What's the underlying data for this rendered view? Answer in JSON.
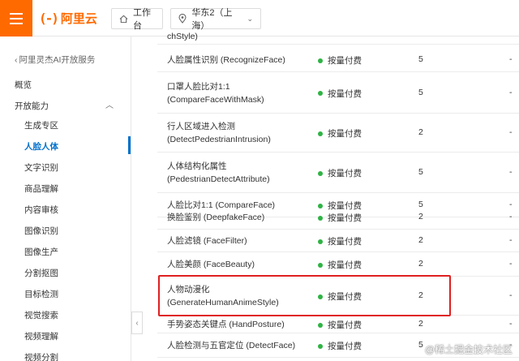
{
  "header": {
    "logo_mark": "(-)",
    "logo_text": "阿里云",
    "workbench_label": "工作台",
    "region_label": "华东2（上海）"
  },
  "sidebar": {
    "back_label": "阿里灵杰AI开放服务",
    "overview": "概览",
    "open_capability": "开放能力",
    "items": [
      "生成专区",
      "人脸人体",
      "文字识别",
      "商品理解",
      "内容审核",
      "图像识别",
      "图像生产",
      "分割抠图",
      "目标检测",
      "视觉搜索",
      "视频理解",
      "视频分割"
    ],
    "active_index": 1
  },
  "table": {
    "top_partial": "chStyle)",
    "rows": [
      {
        "name": "人脸属性识别 (RecognizeFace)",
        "pay": "按量付费",
        "qps": "5",
        "dash": "-"
      },
      {
        "name": "口罩人脸比对1:1 (CompareFaceWithMask)",
        "pay": "按量付费",
        "qps": "5",
        "dash": "-"
      },
      {
        "name": "行人区域进入检测 (DetectPedestrianIntrusion)",
        "pay": "按量付费",
        "qps": "2",
        "dash": "-"
      },
      {
        "name": "人体结构化属性 (PedestrianDetectAttribute)",
        "pay": "按量付费",
        "qps": "5",
        "dash": "-"
      },
      {
        "name": "人脸比对1:1 (CompareFace)",
        "pay": "按量付费",
        "qps": "5",
        "dash": "-"
      },
      {
        "name": "换脸鉴别 (DeepfakeFace)",
        "pay": "按量付费",
        "qps": "2",
        "dash": "-"
      },
      {
        "name": "人脸滤镜 (FaceFilter)",
        "pay": "按量付费",
        "qps": "2",
        "dash": "-"
      },
      {
        "name": "人脸美颜 (FaceBeauty)",
        "pay": "按量付费",
        "qps": "2",
        "dash": "-"
      },
      {
        "name": "人物动漫化 (GenerateHumanAnimeStyle)",
        "pay": "按量付费",
        "qps": "2",
        "dash": "-"
      },
      {
        "name": "手势姿态关键点 (HandPosture)",
        "pay": "按量付费",
        "qps": "2",
        "dash": "-"
      },
      {
        "name": "人脸检测与五官定位 (DetectFace)",
        "pay": "按量付费",
        "qps": "5",
        "dash": "-"
      }
    ]
  },
  "watermark": "@稀土掘金技术社区",
  "colors": {
    "brand": "#ff6a00",
    "active": "#0070cc",
    "status_dot": "#2fb344",
    "highlight": "#e02020"
  }
}
